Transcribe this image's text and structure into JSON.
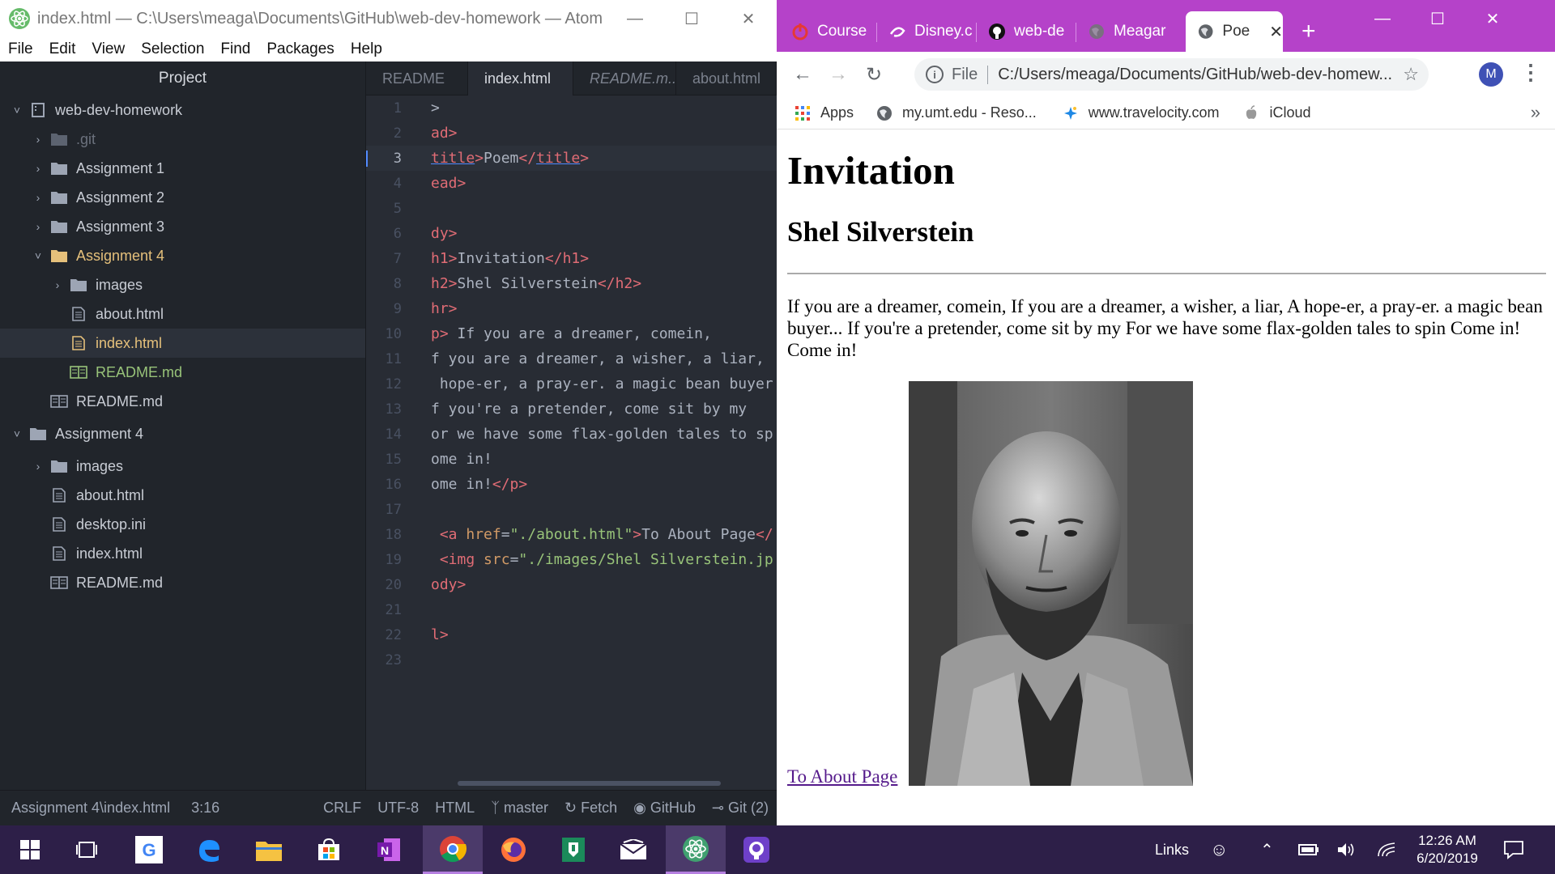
{
  "atom": {
    "window_title": "index.html — C:\\Users\\meaga\\Documents\\GitHub\\web-dev-homework — Atom",
    "menu": [
      "File",
      "Edit",
      "View",
      "Selection",
      "Find",
      "Packages",
      "Help"
    ],
    "tree": {
      "header": "Project",
      "rows": [
        {
          "label": "web-dev-homework",
          "icon": "repo-icon",
          "chevron": "down"
        },
        {
          "label": ".git",
          "icon": "folder-icon",
          "chevron": "right"
        },
        {
          "label": "Assignment 1",
          "icon": "folder-icon",
          "chevron": "right"
        },
        {
          "label": "Assignment 2",
          "icon": "folder-icon",
          "chevron": "right"
        },
        {
          "label": "Assignment 3",
          "icon": "folder-icon",
          "chevron": "right"
        },
        {
          "label": "Assignment 4",
          "icon": "folder-icon",
          "chevron": "down"
        },
        {
          "label": "images",
          "icon": "folder-icon",
          "chevron": "right"
        },
        {
          "label": "about.html",
          "icon": "file-icon"
        },
        {
          "label": "index.html",
          "icon": "file-icon"
        },
        {
          "label": "README.md",
          "icon": "book-icon"
        },
        {
          "label": "README.md",
          "icon": "book-icon"
        },
        {
          "label": "Assignment 4",
          "icon": "folder-icon",
          "chevron": "down"
        },
        {
          "label": "images",
          "icon": "folder-icon",
          "chevron": "right"
        },
        {
          "label": "about.html",
          "icon": "file-icon"
        },
        {
          "label": "desktop.ini",
          "icon": "file-icon"
        },
        {
          "label": "index.html",
          "icon": "file-icon"
        },
        {
          "label": "README.md",
          "icon": "book-icon"
        }
      ]
    },
    "tabs": [
      {
        "label": "README",
        "modified": true
      },
      {
        "label": "index.html",
        "active": true
      },
      {
        "label": "README.m...",
        "italic": true
      },
      {
        "label": "about.html"
      }
    ],
    "code": {
      "line_numbers": [
        "1",
        "2",
        "3",
        "4",
        "5",
        "6",
        "7",
        "8",
        "9",
        "10",
        "11",
        "12",
        "13",
        "14",
        "15",
        "16",
        "17",
        "18",
        "19",
        "20",
        "21",
        "22",
        "23"
      ],
      "cursor_line": 3
    },
    "status": {
      "path": "Assignment 4\\index.html",
      "position": "3:16",
      "line_ending": "CRLF",
      "encoding": "UTF-8",
      "grammar": "HTML",
      "branch": "master",
      "fetch": "Fetch",
      "github": "GitHub",
      "git": "Git (2)"
    }
  },
  "chrome": {
    "tabs": [
      {
        "label": "Course",
        "icon": "power-icon"
      },
      {
        "label": "Disney.c",
        "icon": "disney-icon"
      },
      {
        "label": "web-de",
        "icon": "github-icon"
      },
      {
        "label": "Meagar",
        "icon": "globe-icon"
      },
      {
        "label": "Poe",
        "icon": "globe-icon",
        "active": true
      }
    ],
    "address": {
      "scheme": "File",
      "url": "C:/Users/meaga/Documents/GitHub/web-dev-homew..."
    },
    "avatar": "M",
    "bookmarks": [
      "Apps",
      "my.umt.edu - Reso...",
      "www.travelocity.com",
      "iCloud"
    ],
    "page": {
      "h1": "Invitation",
      "h2": "Shel Silverstein",
      "paragraph": "If you are a dreamer, comein, If you are a dreamer, a wisher, a liar, A hope-er, a pray-er. a magic bean buyer... If you're a pretender, come sit by my For we have some flax-golden tales to spin Come in! Come in!",
      "link": "To About Page"
    }
  },
  "taskbar": {
    "links_label": "Links",
    "time": "12:26 AM",
    "date": "6/20/2019"
  },
  "colors": {
    "chrome_accent": "#b542c9",
    "taskbar": "#2d1f48",
    "atom_bg": "#21252b",
    "editor_bg": "#282c34"
  }
}
